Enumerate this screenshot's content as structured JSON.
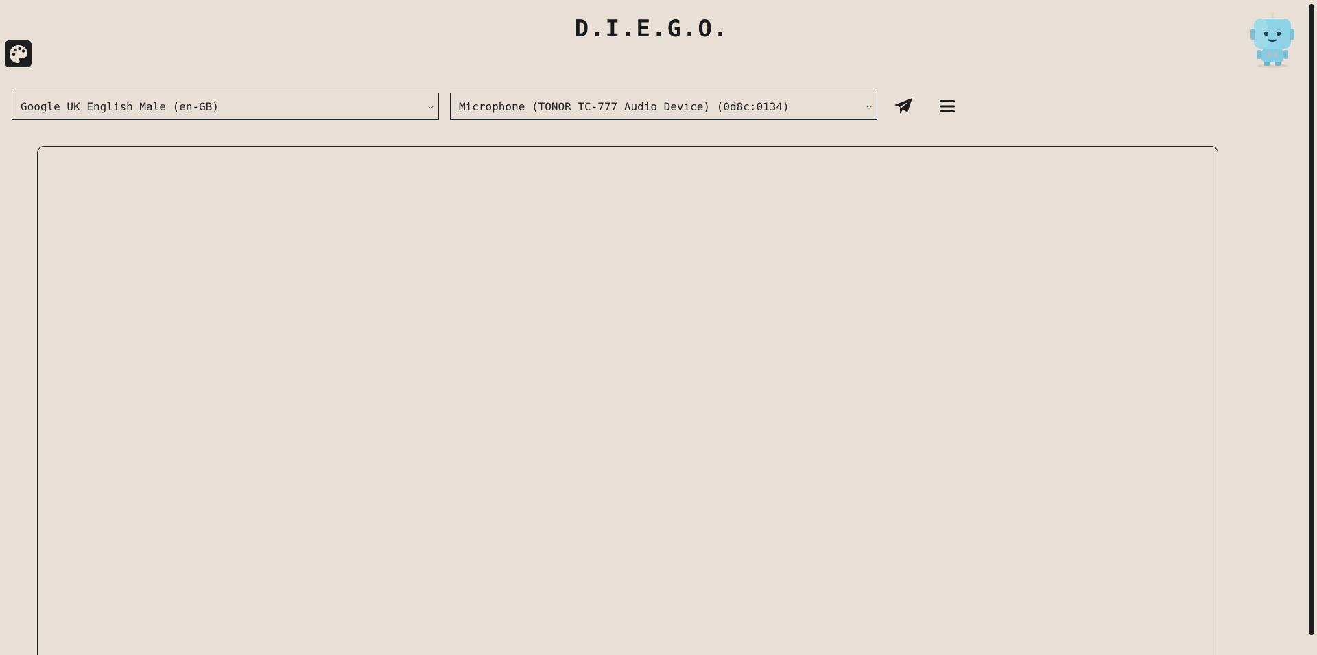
{
  "header": {
    "title": "D.I.E.G.O."
  },
  "toolbar": {
    "voice_select": {
      "selected": "Google UK English Male (en-GB)"
    },
    "mic_select": {
      "selected": "Microphone (TONOR TC-777 Audio Device) (0d8c:0134)"
    }
  },
  "icons": {
    "palette": "palette-icon",
    "send": "paper-plane-icon",
    "menu": "hamburger-menu-icon",
    "avatar": "robot-avatar"
  },
  "colors": {
    "background": "#e8dfd7",
    "foreground": "#1b1b1b",
    "robot_body": "#8fd3e6"
  }
}
